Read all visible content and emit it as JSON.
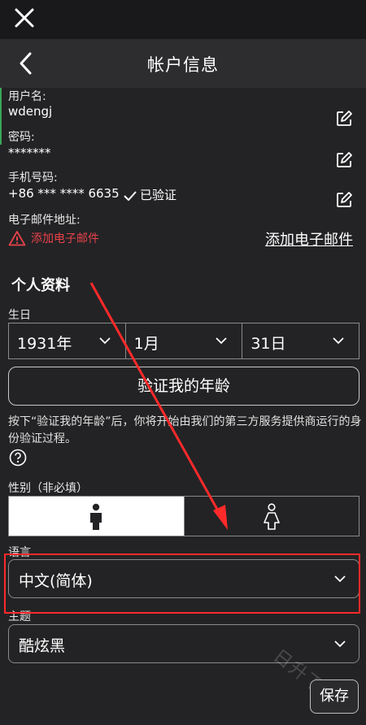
{
  "header": {
    "title": "帐户信息"
  },
  "account": {
    "username_label": "用户名:",
    "username": "wdengj",
    "password_label": "密码:",
    "password": "*******",
    "phone_label": "手机号码:",
    "phone": "+86 *** **** 6635",
    "verified": "已验证",
    "email_label": "电子邮件地址:",
    "email_warning": "添加电子邮件",
    "add_email_link": "添加电子邮件"
  },
  "profile": {
    "section_title": "个人资料",
    "birthday_label": "生日",
    "year": "1931年",
    "month": "1月",
    "day": "31日",
    "verify_age_button": "验证我的年龄",
    "verify_desc": "按下“验证我的年龄”后，你将开始由我们的第三方服务提供商运行的身份验证过程。",
    "gender_label": "性别（非必填）",
    "language_label": "语言",
    "language_value": "中文(简体)",
    "theme_label": "主题",
    "theme_value": "酷炫黑"
  },
  "footer": {
    "save_button": "保存"
  },
  "watermark": "日升下载",
  "colors": {
    "accent_red": "#ff2a2a",
    "warning": "#e8424a",
    "background": "#232325"
  },
  "icons": [
    "close-icon",
    "back-chevron-icon",
    "edit-icon",
    "check-icon",
    "warning-icon",
    "chevron-down-icon",
    "help-icon",
    "male-icon",
    "female-icon"
  ]
}
